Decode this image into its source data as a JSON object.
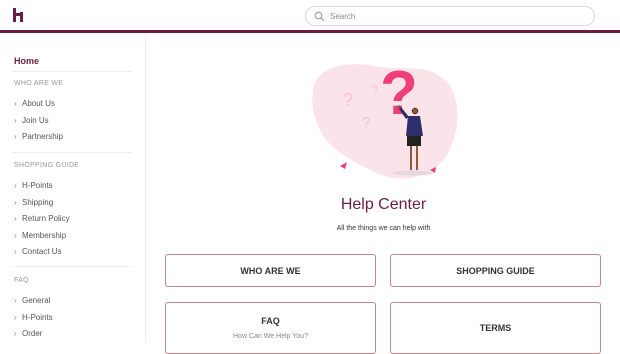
{
  "header": {
    "logo_icon": "h-logo-icon",
    "search": {
      "placeholder": "Search",
      "icon": "search-icon"
    },
    "accent": "#6b1e42"
  },
  "sidebar": {
    "home_label": "Home",
    "sections": [
      {
        "title": "WHO ARE WE",
        "items": [
          "About Us",
          "Join Us",
          "Partnership"
        ]
      },
      {
        "title": "SHOPPING GUIDE",
        "items": [
          "H-Points",
          "Shipping",
          "Return Policy",
          "Membership",
          "Contact Us"
        ]
      },
      {
        "title": "FAQ",
        "items": [
          "General",
          "H-Points",
          "Order"
        ]
      }
    ]
  },
  "main": {
    "title": "Help Center",
    "subtitle": "All the things we can help with",
    "cards": [
      {
        "label": "WHO ARE WE",
        "sub": ""
      },
      {
        "label": "SHOPPING GUIDE",
        "sub": ""
      },
      {
        "label": "FAQ",
        "sub": "How Can We Help You?"
      },
      {
        "label": "TERMS",
        "sub": ""
      }
    ]
  }
}
